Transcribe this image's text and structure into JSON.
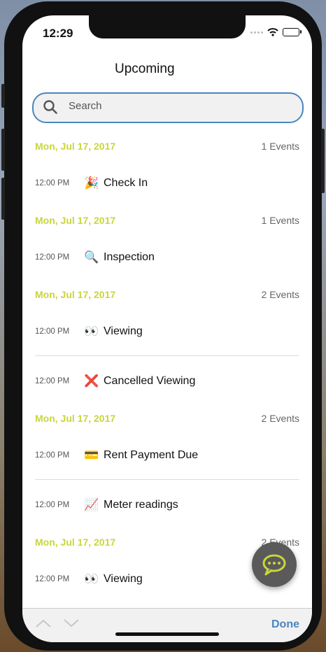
{
  "status": {
    "time": "12:29"
  },
  "header": {
    "title": "Upcoming"
  },
  "search": {
    "placeholder": "Search"
  },
  "days": [
    {
      "date": "Mon, Jul 17, 2017",
      "count": "1 Events",
      "events": [
        {
          "time": "12:00 PM",
          "icon": "🎉",
          "title": "Check In"
        }
      ]
    },
    {
      "date": "Mon, Jul 17, 2017",
      "count": "1 Events",
      "events": [
        {
          "time": "12:00 PM",
          "icon": "🔍",
          "title": "Inspection"
        }
      ]
    },
    {
      "date": "Mon, Jul 17, 2017",
      "count": "2 Events",
      "events": [
        {
          "time": "12:00 PM",
          "icon": "👀",
          "title": "Viewing"
        },
        {
          "time": "12:00 PM",
          "icon": "❌",
          "title": "Cancelled Viewing"
        }
      ]
    },
    {
      "date": "Mon, Jul 17, 2017",
      "count": "2 Events",
      "events": [
        {
          "time": "12:00 PM",
          "icon": "💳",
          "title": "Rent Payment Due"
        },
        {
          "time": "12:00 PM",
          "icon": "📈",
          "title": "Meter readings"
        }
      ]
    },
    {
      "date": "Mon, Jul 17, 2017",
      "count": "2 Events",
      "events": [
        {
          "time": "12:00 PM",
          "icon": "👀",
          "title": "Viewing"
        }
      ]
    }
  ],
  "toolbar": {
    "done_label": "Done"
  },
  "colors": {
    "accent": "#c9d63a",
    "primary": "#4a86bf",
    "fab": "#5a5a5a"
  }
}
